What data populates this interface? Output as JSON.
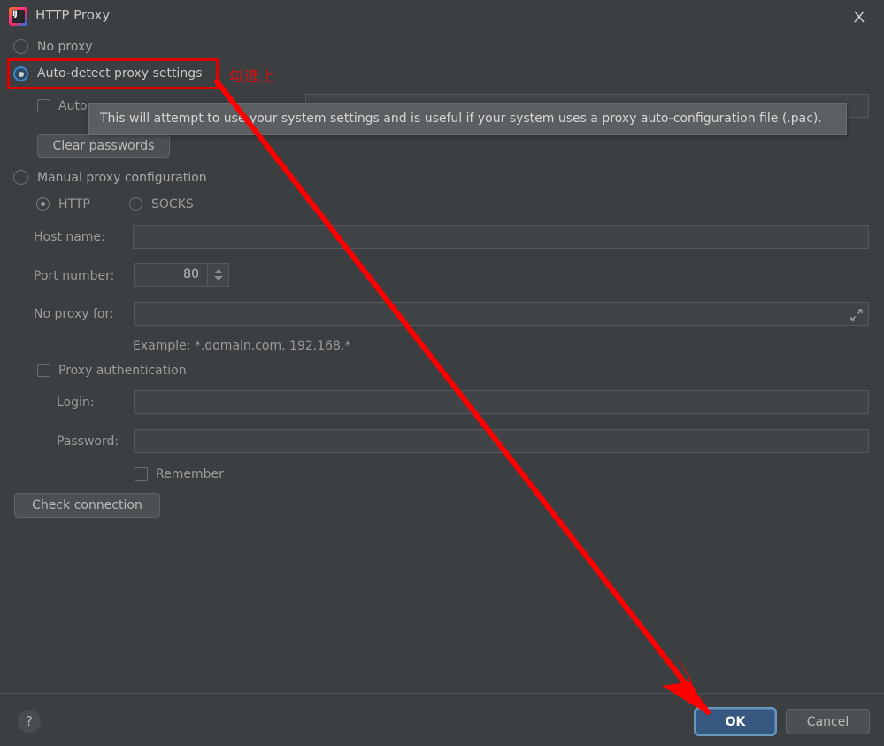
{
  "window": {
    "title": "HTTP Proxy",
    "app_icon": "intellij-idea-icon",
    "close_icon": "close-icon"
  },
  "options": {
    "no_proxy": {
      "label": "No proxy",
      "selected": false
    },
    "auto_detect": {
      "label": "Auto-detect proxy settings",
      "selected": true
    },
    "auto_url_checkbox": {
      "label": "Auto",
      "checked": false
    },
    "clear_passwords": "Clear passwords",
    "manual": {
      "label": "Manual proxy configuration",
      "selected": false
    }
  },
  "tooltip": {
    "text": "This will attempt to use your system settings and is useful if your system uses a proxy auto-configuration file (.pac)."
  },
  "protocol": {
    "http": {
      "label": "HTTP",
      "selected": true
    },
    "socks": {
      "label": "SOCKS",
      "selected": false
    }
  },
  "fields": {
    "host_name": {
      "label": "Host name:",
      "value": "",
      "placeholder": ""
    },
    "port_number": {
      "label": "Port number:",
      "value": "80"
    },
    "no_proxy_for": {
      "label": "No proxy for:",
      "value": "",
      "expand_icon": "expand-icon"
    },
    "example_hint": "Example: *.domain.com, 192.168.*",
    "proxy_auth": {
      "label": "Proxy authentication",
      "checked": false
    },
    "login": {
      "label": "Login:",
      "value": ""
    },
    "password": {
      "label": "Password:",
      "value": ""
    },
    "remember": {
      "label": "Remember",
      "checked": false
    }
  },
  "actions": {
    "check_connection": "Check connection",
    "ok": "OK",
    "cancel": "Cancel",
    "help": "?"
  },
  "annotations": {
    "note_cn": "勾选上",
    "highlight_color": "#e00000",
    "arrow_color": "#ff0000"
  },
  "colors": {
    "dialog_bg": "#3c3f41",
    "input_bg": "#45484a",
    "primary_button": "#365880",
    "accent_focus": "#6897bb",
    "text": "#bbbbbb"
  }
}
